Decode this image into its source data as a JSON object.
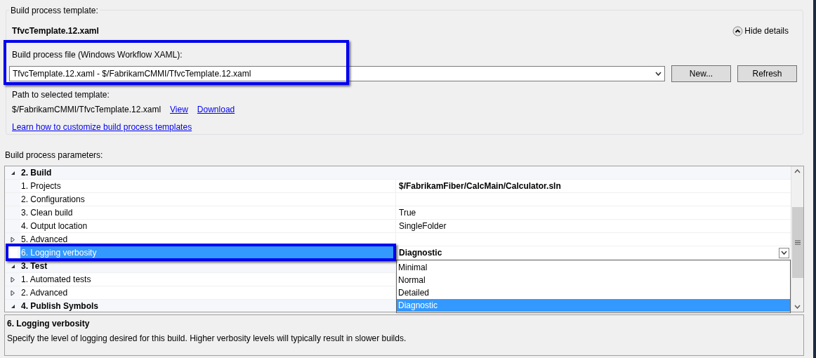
{
  "template_group": {
    "title": "Build process template:",
    "template_name": "TfvcTemplate.12.xaml",
    "details_toggle": "Hide details",
    "file_label": "Build process file (Windows Workflow XAML):",
    "file_value": "TfvcTemplate.12.xaml - $/FabrikamCMMI/TfvcTemplate.12.xaml",
    "buttons": [
      "New...",
      "Refresh"
    ],
    "path_label": "Path to selected template:",
    "path": "$/FabrikamCMMI/TfvcTemplate.12.xaml",
    "path_links": [
      "View",
      "Download"
    ],
    "help_link": "Learn how to customize build process templates"
  },
  "parameters": {
    "title": "Build process parameters:",
    "items": [
      {
        "kind": "category",
        "label": "2. Build",
        "expanded": true,
        "selected": false,
        "children": [
          {
            "kind": "param",
            "label": "1. Projects",
            "value": "$/FabrikamFiber/CalcMain/Calculator.sln",
            "modified": true,
            "selected": false
          },
          {
            "kind": "param",
            "label": "2. Configurations",
            "selected": false
          },
          {
            "kind": "param",
            "label": "3. Clean build",
            "value": "True",
            "modified": false,
            "selected": false
          },
          {
            "kind": "param",
            "label": "4. Output location",
            "value": "SingleFolder",
            "modified": false,
            "selected": false
          },
          {
            "kind": "param",
            "label": "5. Advanced",
            "expanded": false,
            "selected": false
          },
          {
            "kind": "param",
            "label": "6. Logging verbosity",
            "value": "Diagnostic",
            "modified": true,
            "selected": true,
            "dropdown": [
              {
                "label": "Minimal",
                "selected": false
              },
              {
                "label": "Normal",
                "selected": false
              },
              {
                "label": "Detailed",
                "selected": false
              },
              {
                "label": "Diagnostic",
                "selected": true
              }
            ]
          }
        ]
      },
      {
        "kind": "category",
        "label": "3. Test",
        "expanded": true,
        "selected": false,
        "children": [
          {
            "kind": "param",
            "label": "1. Automated tests",
            "expanded": false,
            "selected": false
          },
          {
            "kind": "param",
            "label": "2. Advanced",
            "expanded": false,
            "selected": false
          }
        ]
      },
      {
        "kind": "category",
        "label": "4. Publish Symbols",
        "expanded": true,
        "selected": false
      }
    ]
  },
  "description": {
    "title": "6. Logging verbosity",
    "text": "Specify the level of logging desired for this build. Higher verbosity levels will typically result in slower builds."
  }
}
